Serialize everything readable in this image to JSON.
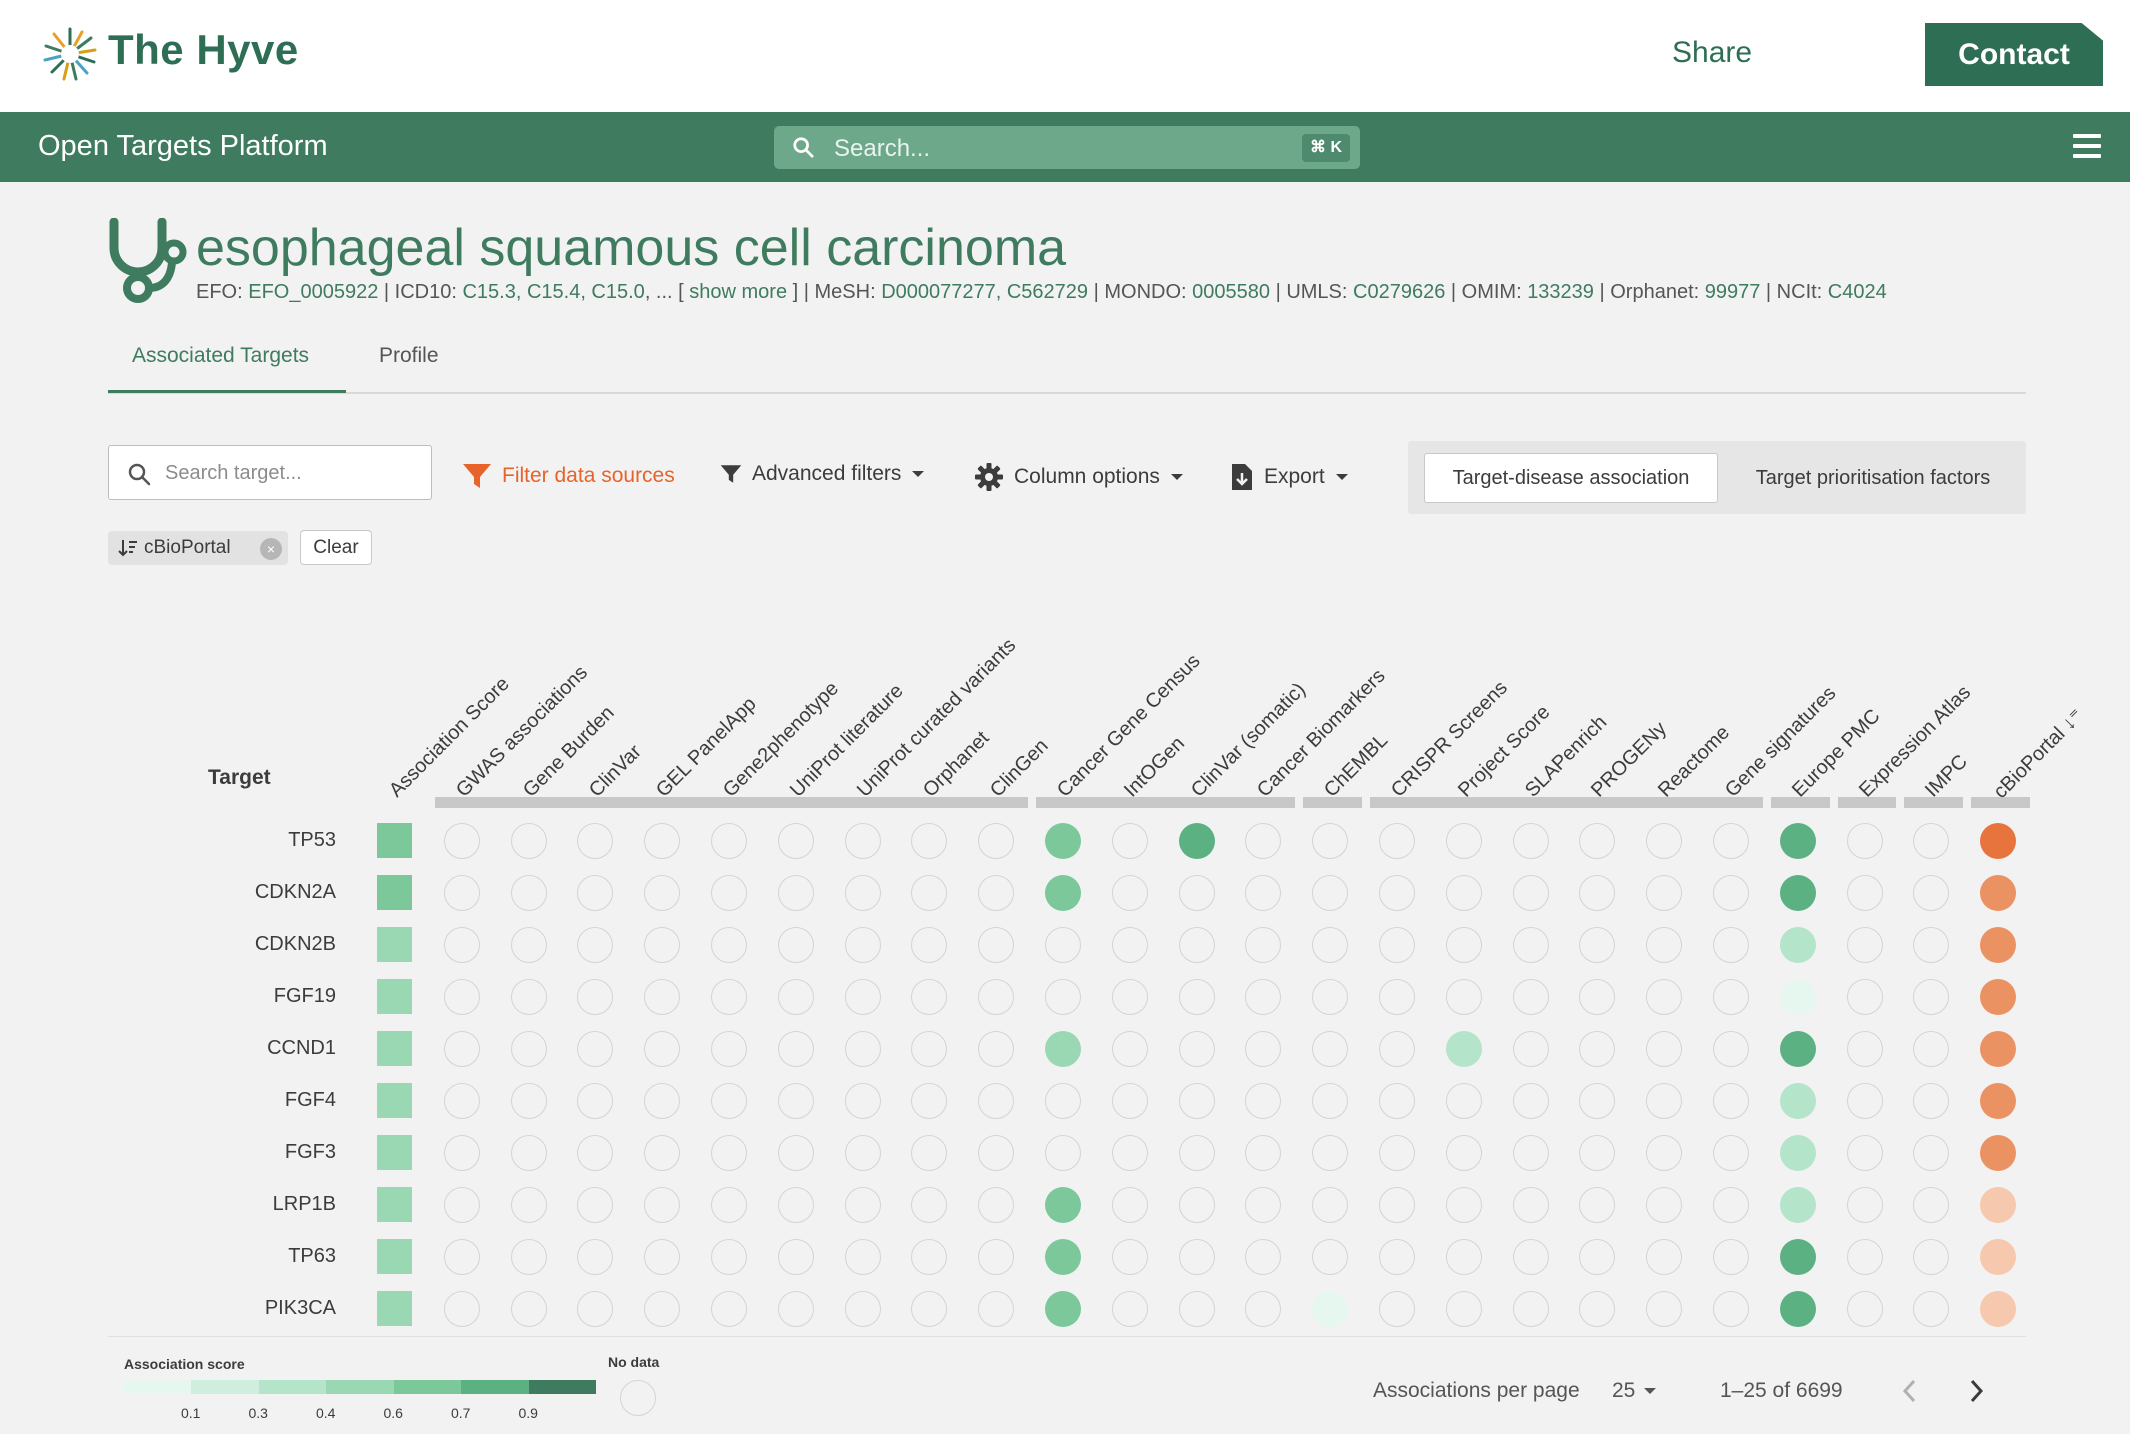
{
  "brand": {
    "name": "The Hyve",
    "share_label": "Share",
    "contact_label": "Contact",
    "accent": "#2e6e55"
  },
  "platform": {
    "title_bold": "Open Targets",
    "title_rest": " Platform",
    "search_placeholder": "Search...",
    "search_shortcut": "⌘ K",
    "menu_icon": "hamburger-menu-icon",
    "header_color": "#3e7b5f"
  },
  "disease": {
    "icon": "stethoscope-icon",
    "title": "esophageal squamous cell carcinoma",
    "xrefs": [
      {
        "label": "EFO: ",
        "value": "EFO_0005922"
      },
      {
        "label": " | ICD10: ",
        "value": "C15.3, C15.4, C15.0"
      },
      {
        "label": ", ... [ ",
        "value": "show more"
      },
      {
        "label": " ] | MeSH: ",
        "value": "D000077277, C562729"
      },
      {
        "label": " | MONDO: ",
        "value": "0005580"
      },
      {
        "label": " | UMLS: ",
        "value": "C0279626"
      },
      {
        "label": " | OMIM: ",
        "value": "133239"
      },
      {
        "label": " | Orphanet: ",
        "value": "99977"
      },
      {
        "label": " | NCIt: ",
        "value": "C4024"
      }
    ]
  },
  "tabs": [
    {
      "label": "Associated Targets",
      "active": true
    },
    {
      "label": "Profile",
      "active": false
    }
  ],
  "toolbar": {
    "search_placeholder": "Search target...",
    "filter_label": "Filter data sources",
    "advanced_label": "Advanced filters",
    "columns_label": "Column options",
    "export_label": "Export",
    "toggle_a": "Target-disease association",
    "toggle_b": "Target prioritisation factors",
    "filter_color": "#e8632a"
  },
  "chips": {
    "active_sort": "cBioPortal",
    "clear_label": "Clear"
  },
  "table": {
    "target_header": "Target",
    "columns": [
      "Association Score",
      "GWAS associations",
      "Gene Burden",
      "ClinVar",
      "GEL PanelApp",
      "Gene2phenotype",
      "UniProt literature",
      "UniProt curated variants",
      "Orphanet",
      "ClinGen",
      "Cancer Gene Census",
      "IntOGen",
      "ClinVar (somatic)",
      "Cancer Biomarkers",
      "ChEMBL",
      "CRISPR Screens",
      "Project Score",
      "SLAPenrich",
      "PROGENy",
      "Reactome",
      "Gene signatures",
      "Europe PMC",
      "Expression Atlas",
      "IMPC",
      "cBioPortal ↓⁼"
    ],
    "rows": [
      {
        "target": "TP53",
        "score": 0.7,
        "cells": {
          "10": 0.6,
          "12": 0.8,
          "21": 0.9,
          "24": 0.9
        }
      },
      {
        "target": "CDKN2A",
        "score": 0.6,
        "cells": {
          "10": 0.6,
          "21": 0.9,
          "24": 0.7
        }
      },
      {
        "target": "CDKN2B",
        "score": 0.5,
        "cells": {
          "21": 0.4,
          "24": 0.7
        }
      },
      {
        "target": "FGF19",
        "score": 0.5,
        "cells": {
          "21": 0.05,
          "24": 0.7
        }
      },
      {
        "target": "CCND1",
        "score": 0.5,
        "cells": {
          "10": 0.5,
          "16": 0.3,
          "21": 0.9,
          "24": 0.7
        }
      },
      {
        "target": "FGF4",
        "score": 0.5,
        "cells": {
          "21": 0.3,
          "24": 0.7
        }
      },
      {
        "target": "FGF3",
        "score": 0.5,
        "cells": {
          "21": 0.3,
          "24": 0.7
        }
      },
      {
        "target": "LRP1B",
        "score": 0.5,
        "cells": {
          "10": 0.6,
          "21": 0.3,
          "24": 0.5
        }
      },
      {
        "target": "TP63",
        "score": 0.5,
        "cells": {
          "10": 0.6,
          "21": 0.9,
          "24": 0.4
        }
      },
      {
        "target": "PIK3CA",
        "score": 0.5,
        "cells": {
          "10": 0.6,
          "14": 0.05,
          "21": 0.9,
          "24": 0.4
        }
      }
    ]
  },
  "legend": {
    "score_title": "Association score",
    "ticks": [
      "0.1",
      "0.3",
      "0.4",
      "0.6",
      "0.7",
      "0.9"
    ],
    "colors": [
      "#e6f7ef",
      "#cfeedd",
      "#b4e4c9",
      "#9ad8b4",
      "#7cc89b",
      "#5cb183",
      "#3e7b5f"
    ],
    "nodata_title": "No data"
  },
  "pagination": {
    "per_page_label": "Associations per page",
    "per_page_value": "25",
    "range": "1–25 of 6699"
  }
}
